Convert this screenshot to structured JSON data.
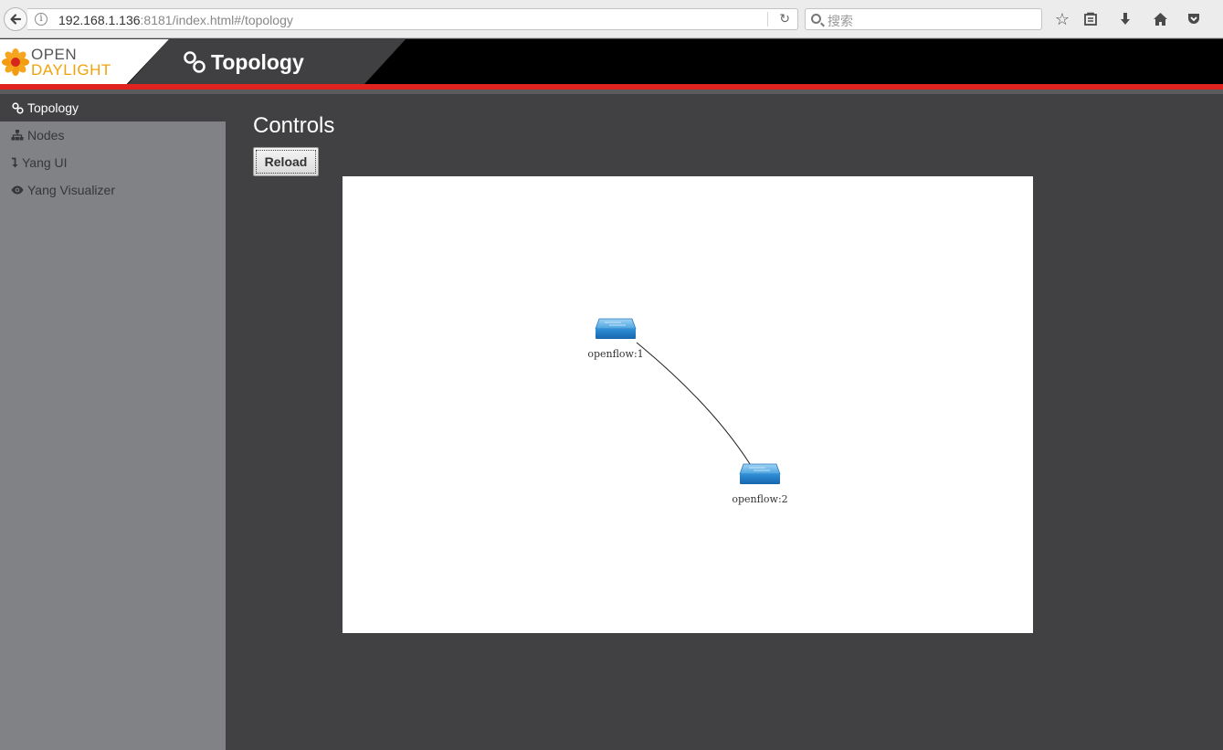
{
  "browser": {
    "url_host": "192.168.1.136",
    "url_rest": ":8181/index.html#/topology",
    "search_placeholder": "搜索"
  },
  "header": {
    "logo_line1": "OPEN",
    "logo_line2": "DAYLIGHT",
    "title": "Topology"
  },
  "sidebar": {
    "items": [
      {
        "label": "Topology",
        "icon": "link-icon",
        "active": true
      },
      {
        "label": "Nodes",
        "icon": "sitemap-icon",
        "active": false
      },
      {
        "label": "Yang UI",
        "icon": "level-down-icon",
        "active": false
      },
      {
        "label": "Yang Visualizer",
        "icon": "eye-icon",
        "active": false
      }
    ]
  },
  "main": {
    "controls_title": "Controls",
    "reload_label": "Reload"
  },
  "topology": {
    "nodes": [
      {
        "id": "openflow:1",
        "label": "openflow:1",
        "type": "switch"
      },
      {
        "id": "openflow:2",
        "label": "openflow:2",
        "type": "switch"
      }
    ],
    "links": [
      {
        "source": "openflow:1",
        "target": "openflow:2"
      }
    ]
  },
  "colors": {
    "header_bg": "#000000",
    "accent_red": "#e0231e",
    "sidebar_bg": "#818286",
    "main_bg": "#414143",
    "logo_orange": "#f0a30a"
  }
}
